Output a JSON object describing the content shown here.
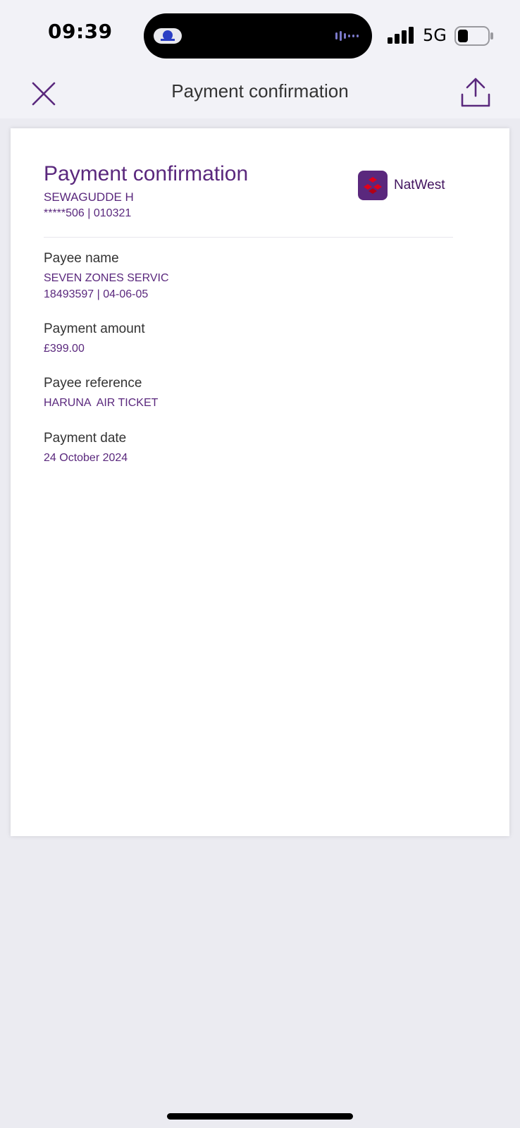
{
  "status_bar": {
    "time": "09:39",
    "network": "5G",
    "signal_icon": "cellular-signal-icon",
    "battery_icon": "battery-icon"
  },
  "nav": {
    "title": "Payment confirmation",
    "close_icon": "close-icon",
    "share_icon": "share-icon"
  },
  "receipt": {
    "title": "Payment confirmation",
    "account_name": "SEWAGUDDE H",
    "account_details": "*****506 | 010321",
    "brand_name": "NatWest",
    "brand_color": "#5a287d",
    "fields": [
      {
        "label": "Payee name",
        "value": "SEVEN ZONES SERVIC",
        "value2": "18493597 | 04-06-05"
      },
      {
        "label": "Payment amount",
        "value": "£399.00"
      },
      {
        "label": "Payee reference",
        "value": "HARUNA  AIR TICKET"
      },
      {
        "label": "Payment date",
        "value": "24 October 2024"
      }
    ]
  }
}
